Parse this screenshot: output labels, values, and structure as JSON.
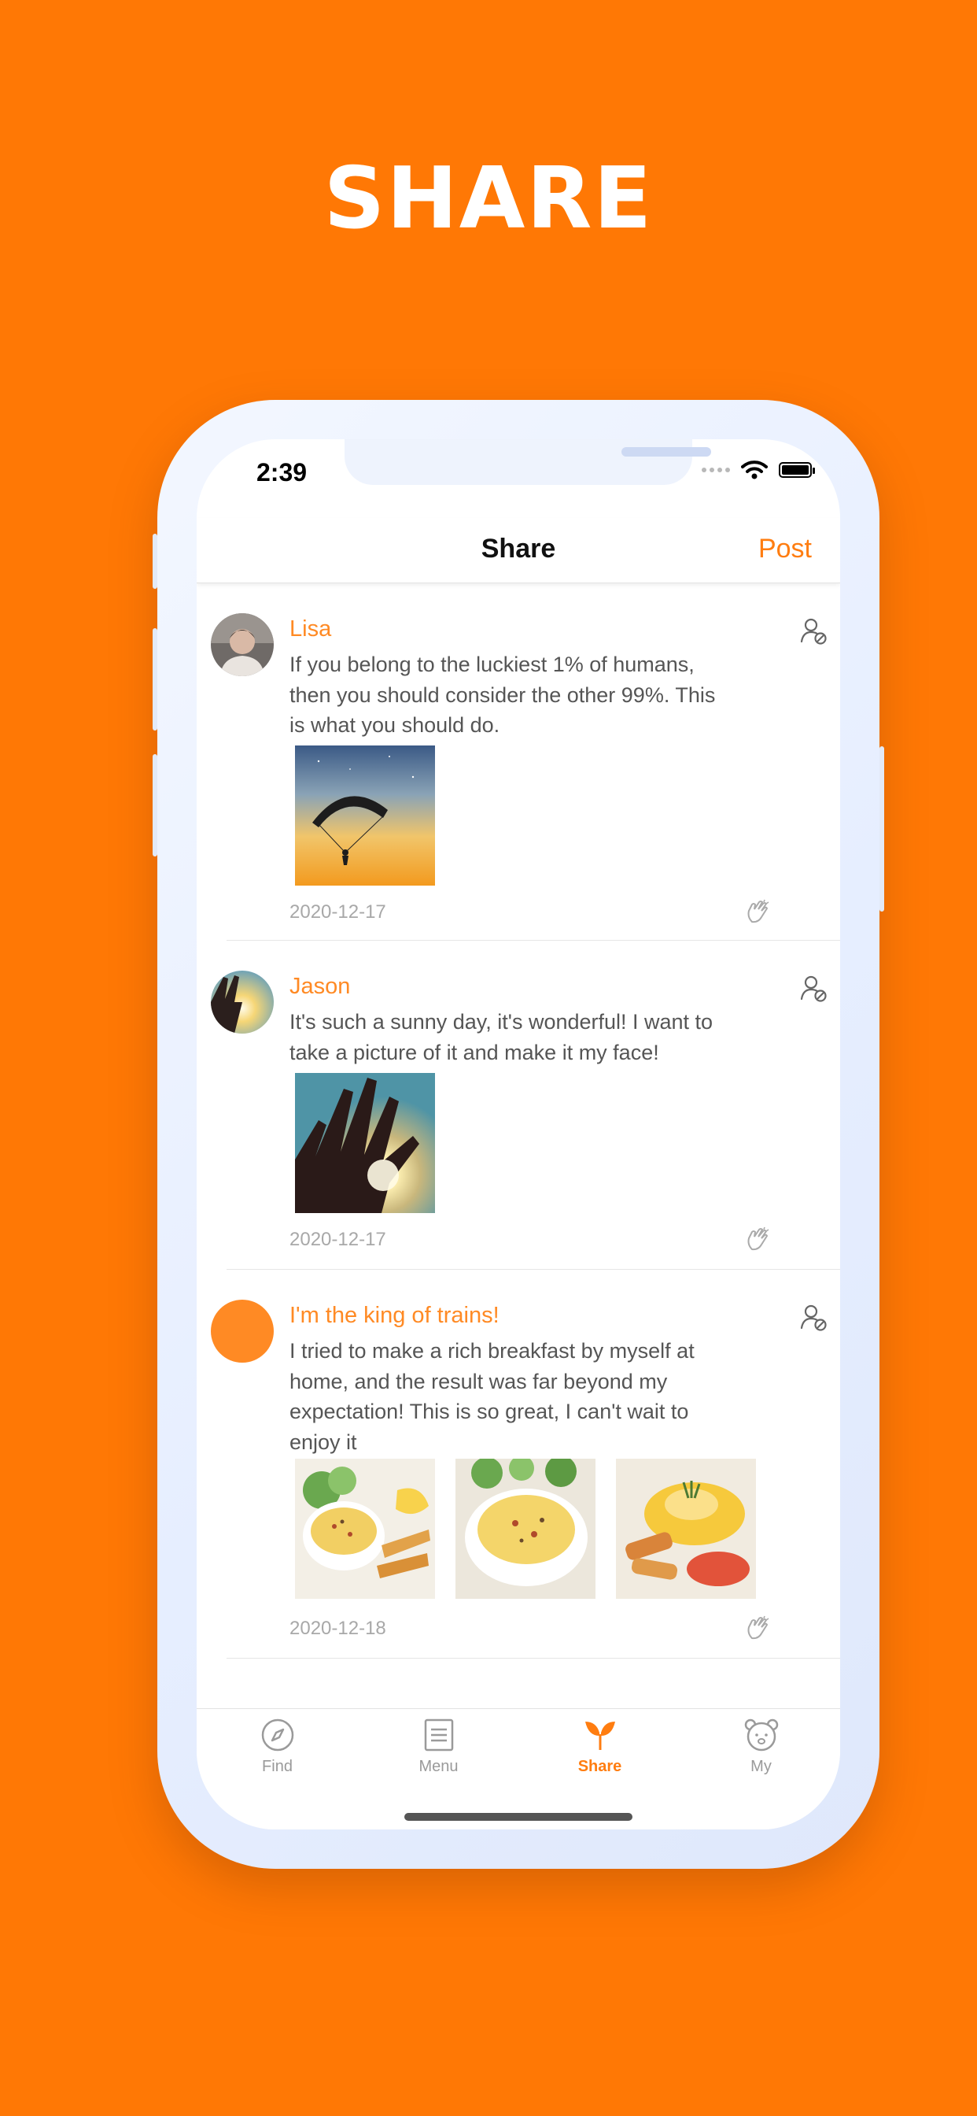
{
  "hero": {
    "title": "SHARE"
  },
  "status_bar": {
    "time": "2:39"
  },
  "navbar": {
    "title": "Share",
    "post_label": "Post"
  },
  "posts": [
    {
      "author": "Lisa",
      "text_lines": [
        "If you belong to the luckiest 1% of humans,",
        "then you should consider the other 99%. This",
        "is what you should do."
      ],
      "date": "2020-12-17",
      "images": [
        "parachute-sunset-photo"
      ]
    },
    {
      "author": "Jason",
      "text_lines": [
        "It's such a sunny day, it's wonderful! I want to",
        "take a picture of it and make it my face!"
      ],
      "date": "2020-12-17",
      "images": [
        "hand-sun-photo"
      ]
    },
    {
      "author": "I'm the king of trains!",
      "text_lines": [
        "I tried to make a rich breakfast by myself at",
        "home, and the result was far beyond my",
        "expectation! This is so great, I can't wait to",
        "enjoy it"
      ],
      "date": "2020-12-18",
      "images": [
        "breakfast-photo-1",
        "breakfast-photo-2",
        "breakfast-photo-3"
      ]
    }
  ],
  "tabbar": {
    "items": [
      {
        "label": "Find",
        "icon": "compass-icon",
        "active": false
      },
      {
        "label": "Menu",
        "icon": "menu-document-icon",
        "active": false
      },
      {
        "label": "Share",
        "icon": "sprout-icon",
        "active": true
      },
      {
        "label": "My",
        "icon": "bear-face-icon",
        "active": false
      }
    ]
  },
  "colors": {
    "background": "#FF7805",
    "accent": "#FF8A24",
    "text": "#555555",
    "muted": "#A8A8A8"
  }
}
